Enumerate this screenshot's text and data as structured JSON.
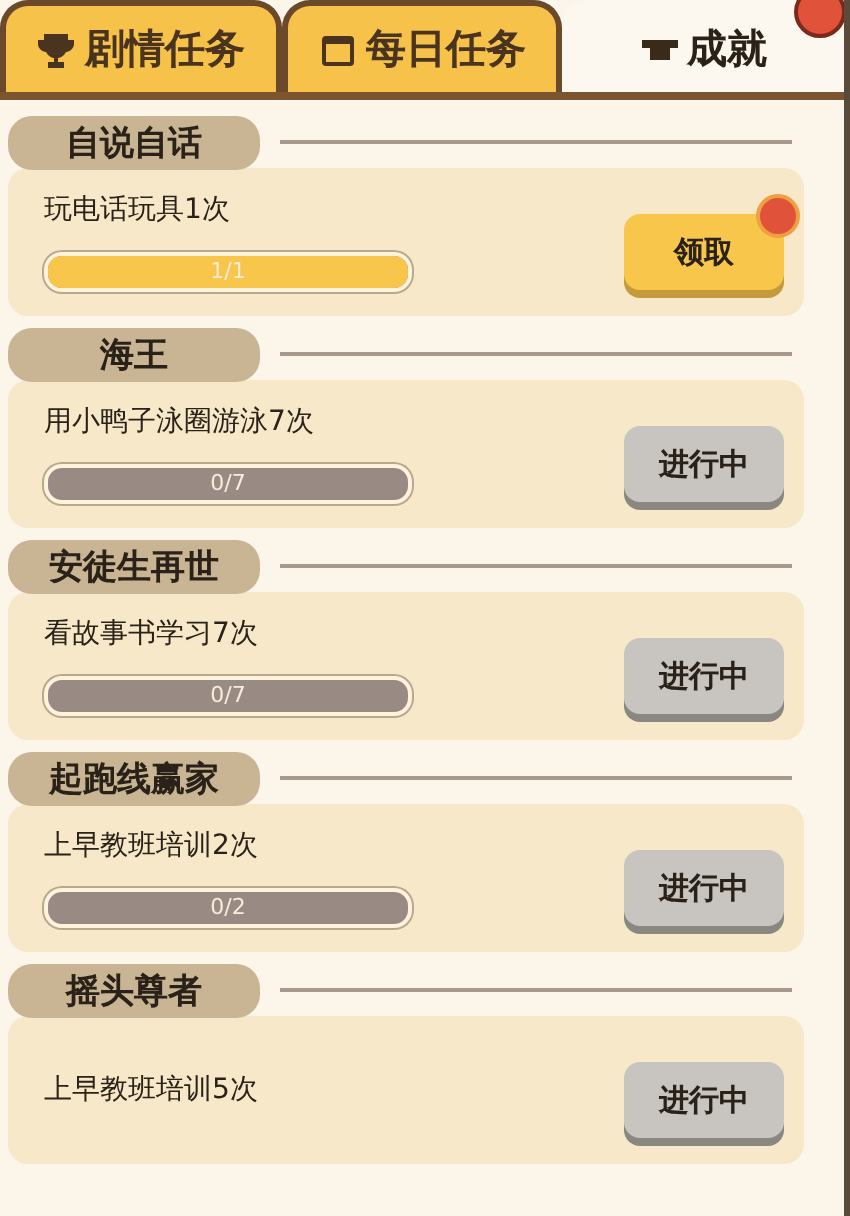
{
  "tabs": [
    {
      "label": "剧情任务",
      "selected": false,
      "alert": false
    },
    {
      "label": "每日任务",
      "selected": false,
      "alert": false
    },
    {
      "label": "成就",
      "selected": true,
      "alert": true
    }
  ],
  "achievements": [
    {
      "title": "自说自话",
      "task": "玩电话玩具1次",
      "level": 1,
      "progress": "1/1",
      "button": {
        "label": "领取",
        "kind": "claim",
        "alert": true
      }
    },
    {
      "title": "海王",
      "task": "用小鸭子泳圈游泳7次",
      "level": 0,
      "progress": "0/7",
      "button": {
        "label": "进行中",
        "kind": "pending",
        "alert": false
      }
    },
    {
      "title": "安徒生再世",
      "task": "看故事书学习7次",
      "level": 0,
      "progress": "0/7",
      "button": {
        "label": "进行中",
        "kind": "pending",
        "alert": false
      }
    },
    {
      "title": "起跑线赢家",
      "task": "上早教班培训2次",
      "level": 0,
      "progress": "0/2",
      "button": {
        "label": "进行中",
        "kind": "pending",
        "alert": false
      }
    },
    {
      "title": "摇头尊者",
      "task": "上早教班培训5次",
      "button": {
        "label": "进行中",
        "kind": "pending",
        "alert": false
      }
    }
  ]
}
